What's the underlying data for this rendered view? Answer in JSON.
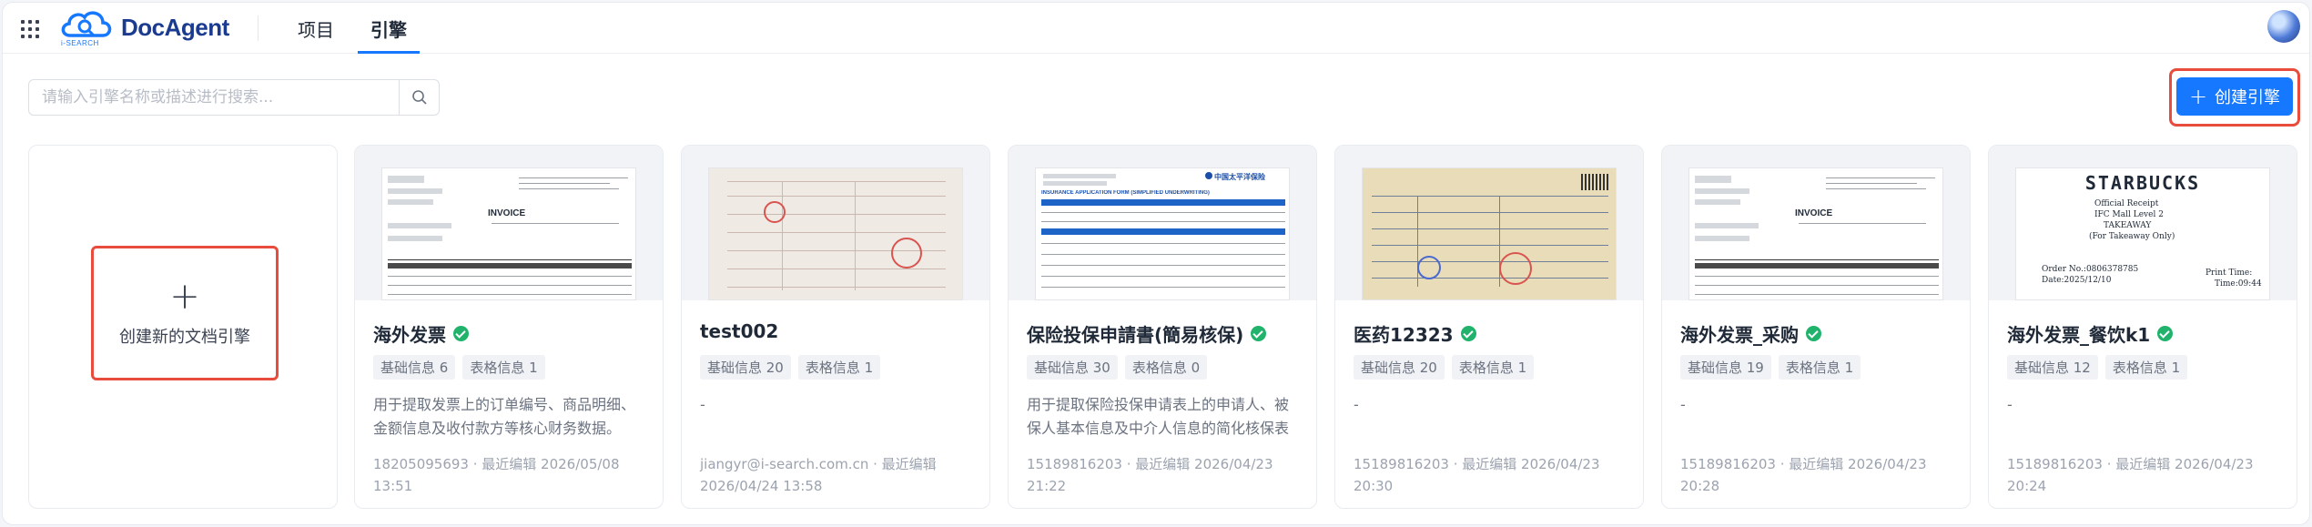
{
  "header": {
    "logo_text": "DocAgent",
    "logo_sub": "i-SEARCH",
    "tabs": [
      {
        "label": "项目"
      },
      {
        "label": "引擎"
      }
    ]
  },
  "toolbar": {
    "search_placeholder": "请输入引擎名称或描述进行搜索...",
    "create_label": "创建引擎"
  },
  "new_card": {
    "plus": "+",
    "label": "创建新的文档引擎"
  },
  "cards": [
    {
      "title": "海外发票",
      "tag_basic": "基础信息 6",
      "tag_table": "表格信息 1",
      "description": "用于提取发票上的订单编号、商品明细、金额信息及收付款方等核心财务数据。",
      "meta": "18205095693 · 最近编辑 2026/05/08 13:51",
      "thumb_word": "INVOICE"
    },
    {
      "title": "test002",
      "tag_basic": "基础信息 20",
      "tag_table": "表格信息 1",
      "description": "-",
      "meta": "jiangyr@i-search.com.cn · 最近编辑 2026/04/24 13:58",
      "thumb_word": ""
    },
    {
      "title": "保险投保申請書(簡易核保)",
      "tag_basic": "基础信息 30",
      "tag_table": "表格信息 0",
      "description": "用于提取保险投保申请表上的申请人、被保人基本信息及中介人信息的简化核保表单数据。",
      "meta": "15189816203 · 最近编辑 2026/04/23 21:22",
      "thumb_word": "INSURANCE APPLICATION FORM (SIMPLIFIED UNDERWRITING)",
      "thumb_brand": "中国太平洋保险"
    },
    {
      "title": "医药12323",
      "tag_basic": "基础信息 20",
      "tag_table": "表格信息 1",
      "description": "-",
      "meta": "15189816203 · 最近编辑 2026/04/23 20:30",
      "thumb_word": ""
    },
    {
      "title": "海外发票_采购",
      "tag_basic": "基础信息 19",
      "tag_table": "表格信息 1",
      "description": "-",
      "meta": "15189816203 · 最近编辑 2026/04/23 20:28",
      "thumb_word": "INVOICE"
    },
    {
      "title": "海外发票_餐饮k1",
      "tag_basic": "基础信息 12",
      "tag_table": "表格信息 1",
      "description": "-",
      "meta": "15189816203 · 最近编辑 2026/04/23 20:24",
      "thumb_word": "STARBUCKS",
      "thumb_lines": [
        "Official Receipt",
        "IFC Mall Level 2",
        "TAKEAWAY",
        "(For Takeaway Only)",
        "Order No.:0806378785",
        "Date:2025/12/10",
        "Print Time:",
        "Time:09:44"
      ]
    }
  ],
  "colors": {
    "primary": "#1677ff",
    "highlight_border": "#e74c3c",
    "success": "#21b36b"
  }
}
